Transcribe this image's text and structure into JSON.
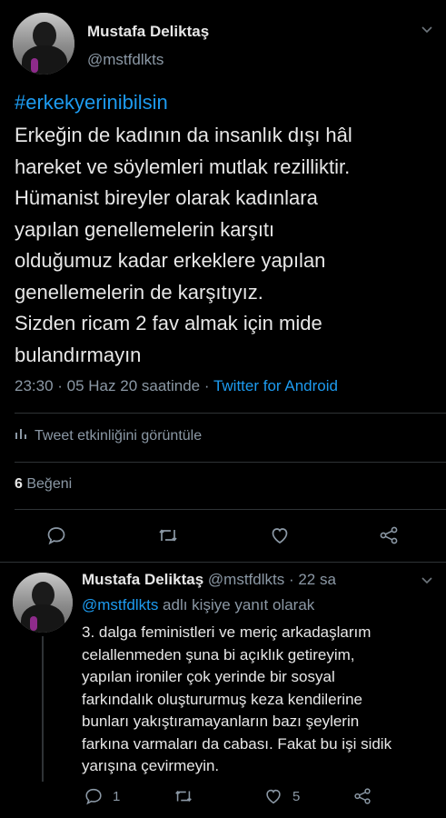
{
  "tweet": {
    "author_name": "Mustafa Deliktaş",
    "author_handle": "@mstfdlkts",
    "hashtag": "#erkekyerinibilsin",
    "text_lines": [
      "Erkeğin de kadının da insanlık dışı hâl",
      "hareket ve söylemleri mutlak rezilliktir.",
      "Hümanist bireyler olarak kadınlara",
      "yapılan genellemelerin karşıtı",
      "olduğumuz kadar erkeklere yapılan",
      "genellemelerin de karşıtıyız.",
      "Sizden ricam 2 fav almak için mide",
      "bulandırmayın"
    ],
    "timestamp": "23:30 · 05 Haz 20 saatinde · ",
    "source": "Twitter for Android",
    "activity_label": "Tweet etkinliğini görüntüle",
    "like_count": "6",
    "like_label": " Beğeni"
  },
  "reply": {
    "author_name": "Mustafa Deliktaş",
    "author_handle": " @mstfdlkts · 22 sa",
    "reply_to_mention": "@mstfdlkts",
    "reply_to_suffix": " adlı kişiye yanıt olarak",
    "text_lines": [
      "3. dalga feministleri ve meriç arkadaşlarım",
      "celallenmeden şuna bi açıklık getireyim,",
      "yapılan ironiler çok yerinde bir sosyal",
      "farkındalık oluştururmuş keza kendilerine",
      "bunları yakıştıramayanların bazı şeylerin",
      "farkına varmaları da cabası. Fakat bu işi sidik",
      "yarışına çevirmeyin."
    ],
    "reply_count": "1",
    "like_count": "5"
  },
  "colors": {
    "background": "#000000",
    "link": "#1d9bf0",
    "muted": "#8b98a5",
    "text": "#e7e7e7",
    "divider": "#2f3336"
  },
  "icons": [
    "chevron-down-icon",
    "bar-chart-icon",
    "comment-icon",
    "retweet-icon",
    "heart-icon",
    "share-icon"
  ]
}
